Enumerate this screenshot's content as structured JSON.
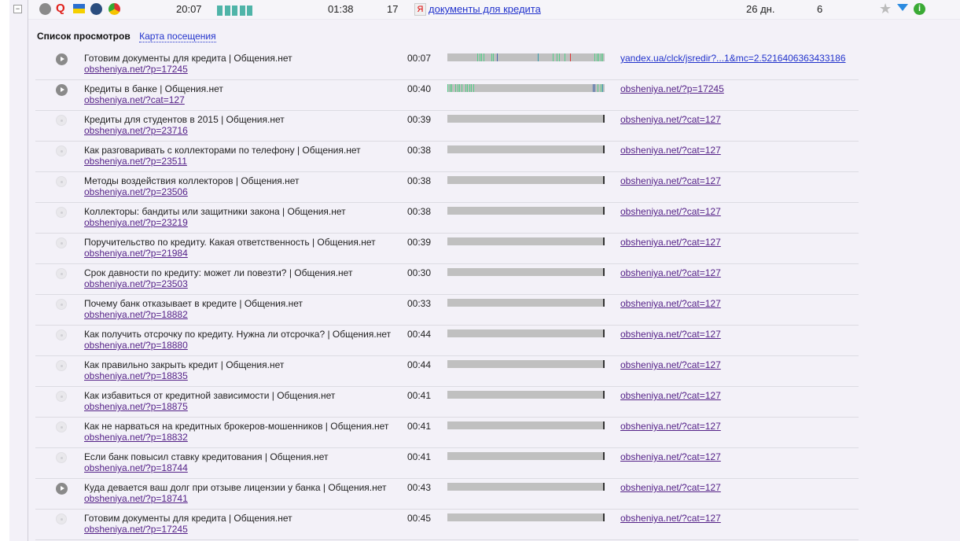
{
  "visit": {
    "time": "20:07",
    "duration": "01:38",
    "views": "17",
    "search_phrase": "документы для кредита",
    "age": "26 дн.",
    "visits": "6",
    "activity_bars": 5,
    "icons": [
      "play-icon",
      "search-engine-icon",
      "ukraine-flag-icon",
      "windows-7-icon",
      "chrome-icon"
    ],
    "actions": [
      "favorite-star-icon",
      "filter-icon",
      "info-icon"
    ]
  },
  "tabs": {
    "list": "Список просмотров",
    "map": "Карта посещения"
  },
  "colors": {
    "accent_link": "#2233cc",
    "visited_link": "#552288",
    "activity": "#4fb4a8"
  },
  "views": [
    {
      "title": "Готовим документы для кредита | Общения.нет",
      "url": "obsheniya.net/?p=17245",
      "time": "00:07",
      "referrer": "yandex.ua/clck/jsredir?...1&mc=2.5216406363433186",
      "played": true,
      "ref_visited": false
    },
    {
      "title": "Кредиты в банке | Общения.нет",
      "url": "obsheniya.net/?cat=127",
      "time": "00:40",
      "referrer": "obsheniya.net/?p=17245",
      "played": true,
      "ref_visited": true
    },
    {
      "title": "Кредиты для студентов в 2015 | Общения.нет",
      "url": "obsheniya.net/?p=23716",
      "time": "00:39",
      "referrer": "obsheniya.net/?cat=127",
      "played": false,
      "ref_visited": true
    },
    {
      "title": "Как разговаривать с коллекторами по телефону | Общения.нет",
      "url": "obsheniya.net/?p=23511",
      "time": "00:38",
      "referrer": "obsheniya.net/?cat=127",
      "played": false,
      "ref_visited": true
    },
    {
      "title": "Методы воздействия коллекторов | Общения.нет",
      "url": "obsheniya.net/?p=23506",
      "time": "00:38",
      "referrer": "obsheniya.net/?cat=127",
      "played": false,
      "ref_visited": true
    },
    {
      "title": "Коллекторы: бандиты или защитники закона | Общения.нет",
      "url": "obsheniya.net/?p=23219",
      "time": "00:38",
      "referrer": "obsheniya.net/?cat=127",
      "played": false,
      "ref_visited": true
    },
    {
      "title": "Поручительство по кредиту. Какая ответственность | Общения.нет",
      "url": "obsheniya.net/?p=21984",
      "time": "00:39",
      "referrer": "obsheniya.net/?cat=127",
      "played": false,
      "ref_visited": true
    },
    {
      "title": "Срок давности по кредиту: может ли повезти? | Общения.нет",
      "url": "obsheniya.net/?p=23503",
      "time": "00:30",
      "referrer": "obsheniya.net/?cat=127",
      "played": false,
      "ref_visited": true
    },
    {
      "title": "Почему банк отказывает в кредите | Общения.нет",
      "url": "obsheniya.net/?p=18882",
      "time": "00:33",
      "referrer": "obsheniya.net/?cat=127",
      "played": false,
      "ref_visited": true
    },
    {
      "title": "Как получить отсрочку по кредиту. Нужна ли отсрочка? | Общения.нет",
      "url": "obsheniya.net/?p=18880",
      "time": "00:44",
      "referrer": "obsheniya.net/?cat=127",
      "played": false,
      "ref_visited": true
    },
    {
      "title": "Как правильно закрыть кредит | Общения.нет",
      "url": "obsheniya.net/?p=18835",
      "time": "00:44",
      "referrer": "obsheniya.net/?cat=127",
      "played": false,
      "ref_visited": true
    },
    {
      "title": "Как избавиться от кредитной зависимости | Общения.нет",
      "url": "obsheniya.net/?p=18875",
      "time": "00:41",
      "referrer": "obsheniya.net/?cat=127",
      "played": false,
      "ref_visited": true
    },
    {
      "title": "Как не нарваться на кредитных брокеров-мошенников | Общения.нет",
      "url": "obsheniya.net/?p=18832",
      "time": "00:41",
      "referrer": "obsheniya.net/?cat=127",
      "played": false,
      "ref_visited": true
    },
    {
      "title": "Если банк повысил ставку кредитования | Общения.нет",
      "url": "obsheniya.net/?p=18744",
      "time": "00:41",
      "referrer": "obsheniya.net/?cat=127",
      "played": false,
      "ref_visited": true
    },
    {
      "title": "Куда девается ваш долг при отзыве лицензии у банка | Общения.нет",
      "url": "obsheniya.net/?p=18741",
      "time": "00:43",
      "referrer": "obsheniya.net/?cat=127",
      "played": true,
      "ref_visited": true
    },
    {
      "title": "Готовим документы для кредита | Общения.нет",
      "url": "obsheniya.net/?p=17245",
      "time": "00:45",
      "referrer": "obsheniya.net/?cat=127",
      "played": false,
      "ref_visited": true
    }
  ]
}
